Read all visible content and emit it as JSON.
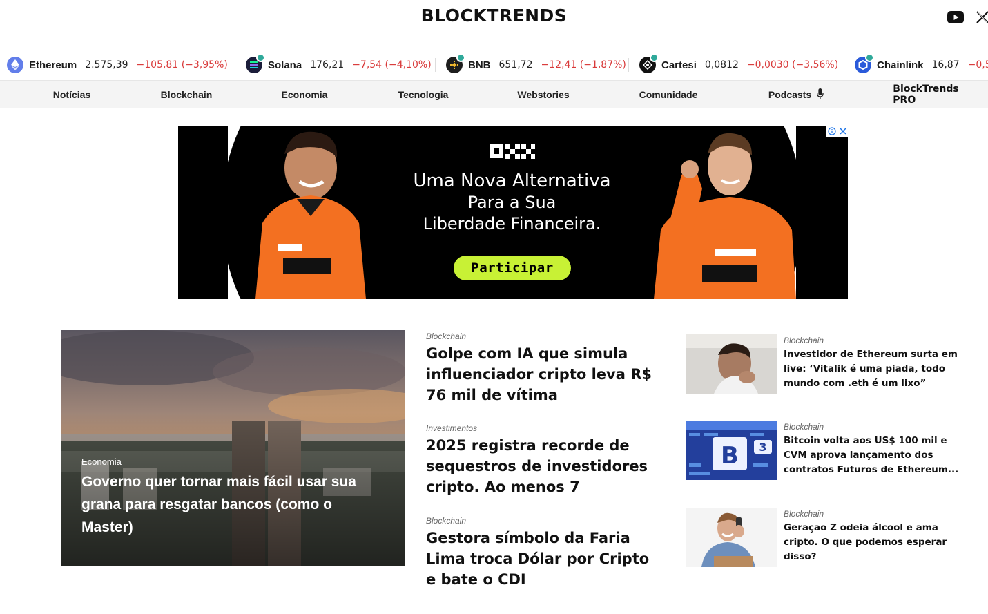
{
  "header": {
    "logo": "BLOCKTRENDS",
    "social": [
      {
        "icon": "youtube-icon"
      },
      {
        "icon": "x-icon"
      }
    ]
  },
  "ticker": [
    {
      "name": "Ethereum",
      "price": "2.575,39",
      "change": "−105,81 (−3,95%)",
      "icon": "ethereum-icon",
      "color": "#627eea"
    },
    {
      "name": "Solana",
      "price": "176,21",
      "change": "−7,54 (−4,10%)",
      "icon": "solana-icon",
      "color": "#1b1d3a"
    },
    {
      "name": "BNB",
      "price": "651,72",
      "change": "−12,41 (−1,87%)",
      "icon": "bnb-icon",
      "color": "#1e1e1e"
    },
    {
      "name": "Cartesi",
      "price": "0,0812",
      "change": "−0,0030 (−3,56%)",
      "icon": "cartesi-icon",
      "color": "#111111"
    },
    {
      "name": "Chainlink",
      "price": "16,87",
      "change": "−0,5",
      "icon": "chainlink-icon",
      "color": "#2a5ada"
    }
  ],
  "nav": [
    {
      "label": "Notícias"
    },
    {
      "label": "Blockchain"
    },
    {
      "label": "Economia"
    },
    {
      "label": "Tecnologia"
    },
    {
      "label": "Webstories"
    },
    {
      "label": "Comunidade"
    },
    {
      "label": "Podcasts",
      "icon": "microphone-icon"
    },
    {
      "label": "BlockTrends PRO"
    }
  ],
  "ad": {
    "brand": "OKX",
    "headline": [
      "Uma Nova Alternativa",
      "Para a Sua",
      "Liberdade Financeira."
    ],
    "cta": "Participar",
    "accent_color": "#c8f135"
  },
  "featured": {
    "category": "Economia",
    "title": "Governo quer tornar mais fácil usar sua grana para resgatar bancos (como o Master)"
  },
  "middle_articles": [
    {
      "category": "Blockchain",
      "title": "Golpe com IA que simula influenciador cripto leva R$ 76 mil de vítima"
    },
    {
      "category": "Investimentos",
      "title": "2025 registra recorde de sequestros de investidores cripto. Ao menos 7"
    },
    {
      "category": "Blockchain",
      "title": "Gestora símbolo da Faria Lima troca Dólar por Cripto e bate o CDI"
    }
  ],
  "side_articles": [
    {
      "category": "Blockchain",
      "title": "Investidor de Ethereum surta em live: ‘Vitalik é uma piada, todo mundo com .eth é um lixo”"
    },
    {
      "category": "Blockchain",
      "title": "Bitcoin volta aos US$ 100 mil e CVM aprova lançamento dos contratos Futuros de Ethereum..."
    },
    {
      "category": "Blockchain",
      "title": "Geração Z odeia álcool e ama cripto. O que podemos esperar disso?"
    }
  ],
  "colors": {
    "negative": "#d93a3a",
    "nav_bg": "#f4f4f4"
  }
}
